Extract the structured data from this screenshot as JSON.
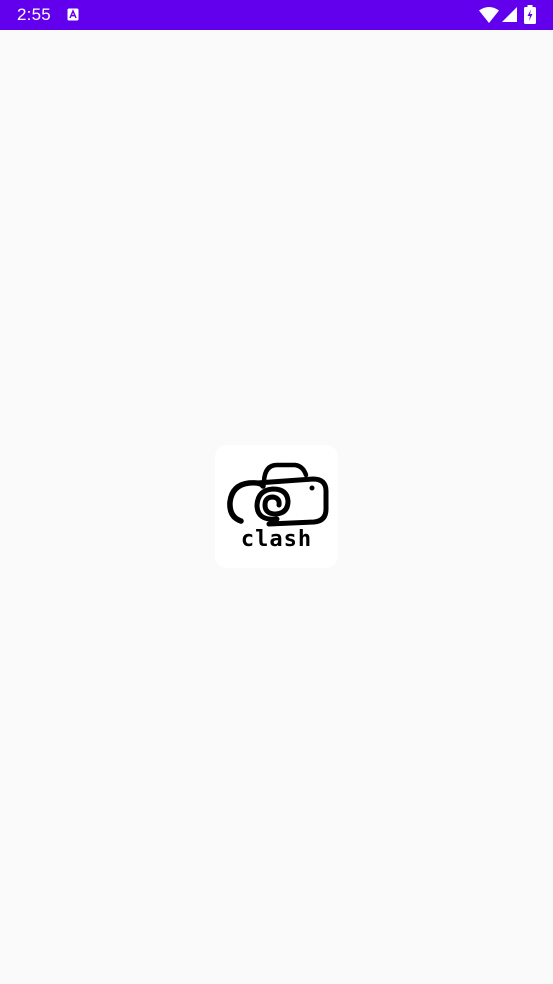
{
  "status_bar": {
    "time": "2:55",
    "background_color": "#6200ee",
    "icons": {
      "notification": "a-notification-icon",
      "wifi": "wifi-icon",
      "signal": "cellular-signal-icon",
      "battery": "battery-charging-icon"
    }
  },
  "splash": {
    "background_color": "#fafafa",
    "logo": {
      "icon": "camera-icon",
      "text": "clash"
    }
  }
}
